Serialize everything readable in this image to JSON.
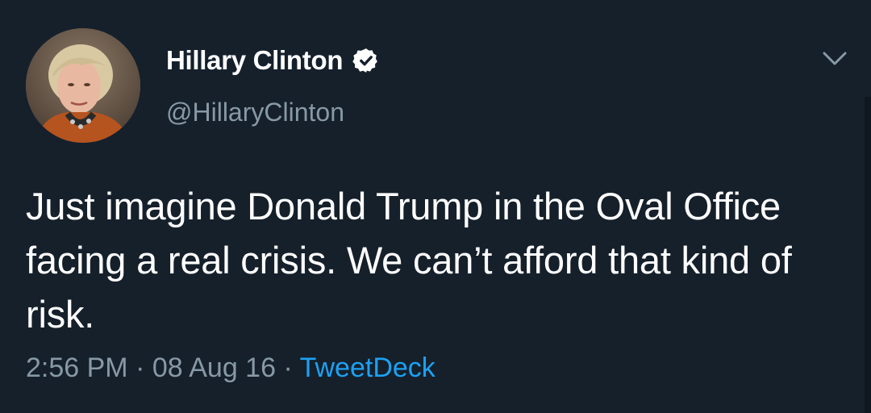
{
  "tweet": {
    "display_name": "Hillary Clinton",
    "handle": "@HillaryClinton",
    "text": "Just imagine Donald Trump in the Oval Office facing a real crisis. We can’t afford that kind of risk.",
    "time": "2:56 PM",
    "separator": " · ",
    "date": "08 Aug 16",
    "source": "TweetDeck"
  },
  "icons": {
    "verified": "verified-badge-icon",
    "menu": "chevron-down-icon"
  },
  "colors": {
    "background": "#15202b",
    "text": "#ffffff",
    "muted": "#8899a6",
    "accent": "#1da1f2"
  }
}
